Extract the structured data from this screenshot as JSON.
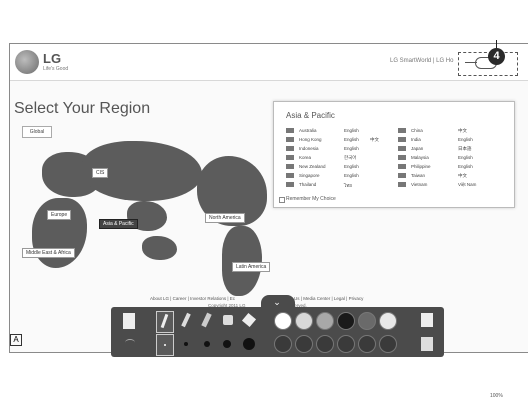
{
  "callout_number": "4",
  "header": {
    "logo_text": "LG",
    "tagline": "Life's Good",
    "top_links": "LG SmartWorld  |  LG Ho"
  },
  "region": {
    "title": "Select Your Region",
    "global_label": "Global",
    "labels": {
      "cis": "CIS",
      "europe": "Europe",
      "asia_pacific": "Asia & Pacific",
      "north_america": "North America",
      "middle_east_africa": "Middle East & Africa",
      "latin_america": "Latin America"
    }
  },
  "asia_panel": {
    "title": "Asia & Pacific",
    "left_column": [
      {
        "name": "Australia",
        "lang1": "English",
        "lang2": ""
      },
      {
        "name": "Hong Kong",
        "lang1": "English",
        "lang2": "中文"
      },
      {
        "name": "Indonesia",
        "lang1": "English",
        "lang2": ""
      },
      {
        "name": "Korea",
        "lang1": "한국어",
        "lang2": ""
      },
      {
        "name": "New Zealand",
        "lang1": "English",
        "lang2": ""
      },
      {
        "name": "Singapore",
        "lang1": "English",
        "lang2": ""
      },
      {
        "name": "Thailand",
        "lang1": "ไทย",
        "lang2": ""
      }
    ],
    "right_column": [
      {
        "name": "China",
        "lang1": "中文"
      },
      {
        "name": "India",
        "lang1": "English"
      },
      {
        "name": "Japan",
        "lang1": "日本語"
      },
      {
        "name": "Malaysia",
        "lang1": "English"
      },
      {
        "name": "Philippine",
        "lang1": "English"
      },
      {
        "name": "Taiwan",
        "lang1": "中文"
      },
      {
        "name": "Vietnam",
        "lang1": "Việt Nam"
      }
    ],
    "remember_label": "Remember My Choice"
  },
  "footer": {
    "links": "About LG  |  Career  |  Investor Relations  |  Ec",
    "links_tail": "ntact Us  |  Media Center  |  Legal  |  Privacy",
    "copyright": "Copyright 2011 LG",
    "copyright_tail": "ights Reserved."
  },
  "toolbar": {
    "chevron_icon": "chevron-down-icon",
    "colors": [
      "#ffffff",
      "#d8d8d8",
      "#a8a8a8",
      "#1a1a1a",
      "#6a6a6a",
      "#e8e8e8"
    ]
  },
  "statusbar": {
    "a_label": "A",
    "zoom": "100%"
  }
}
